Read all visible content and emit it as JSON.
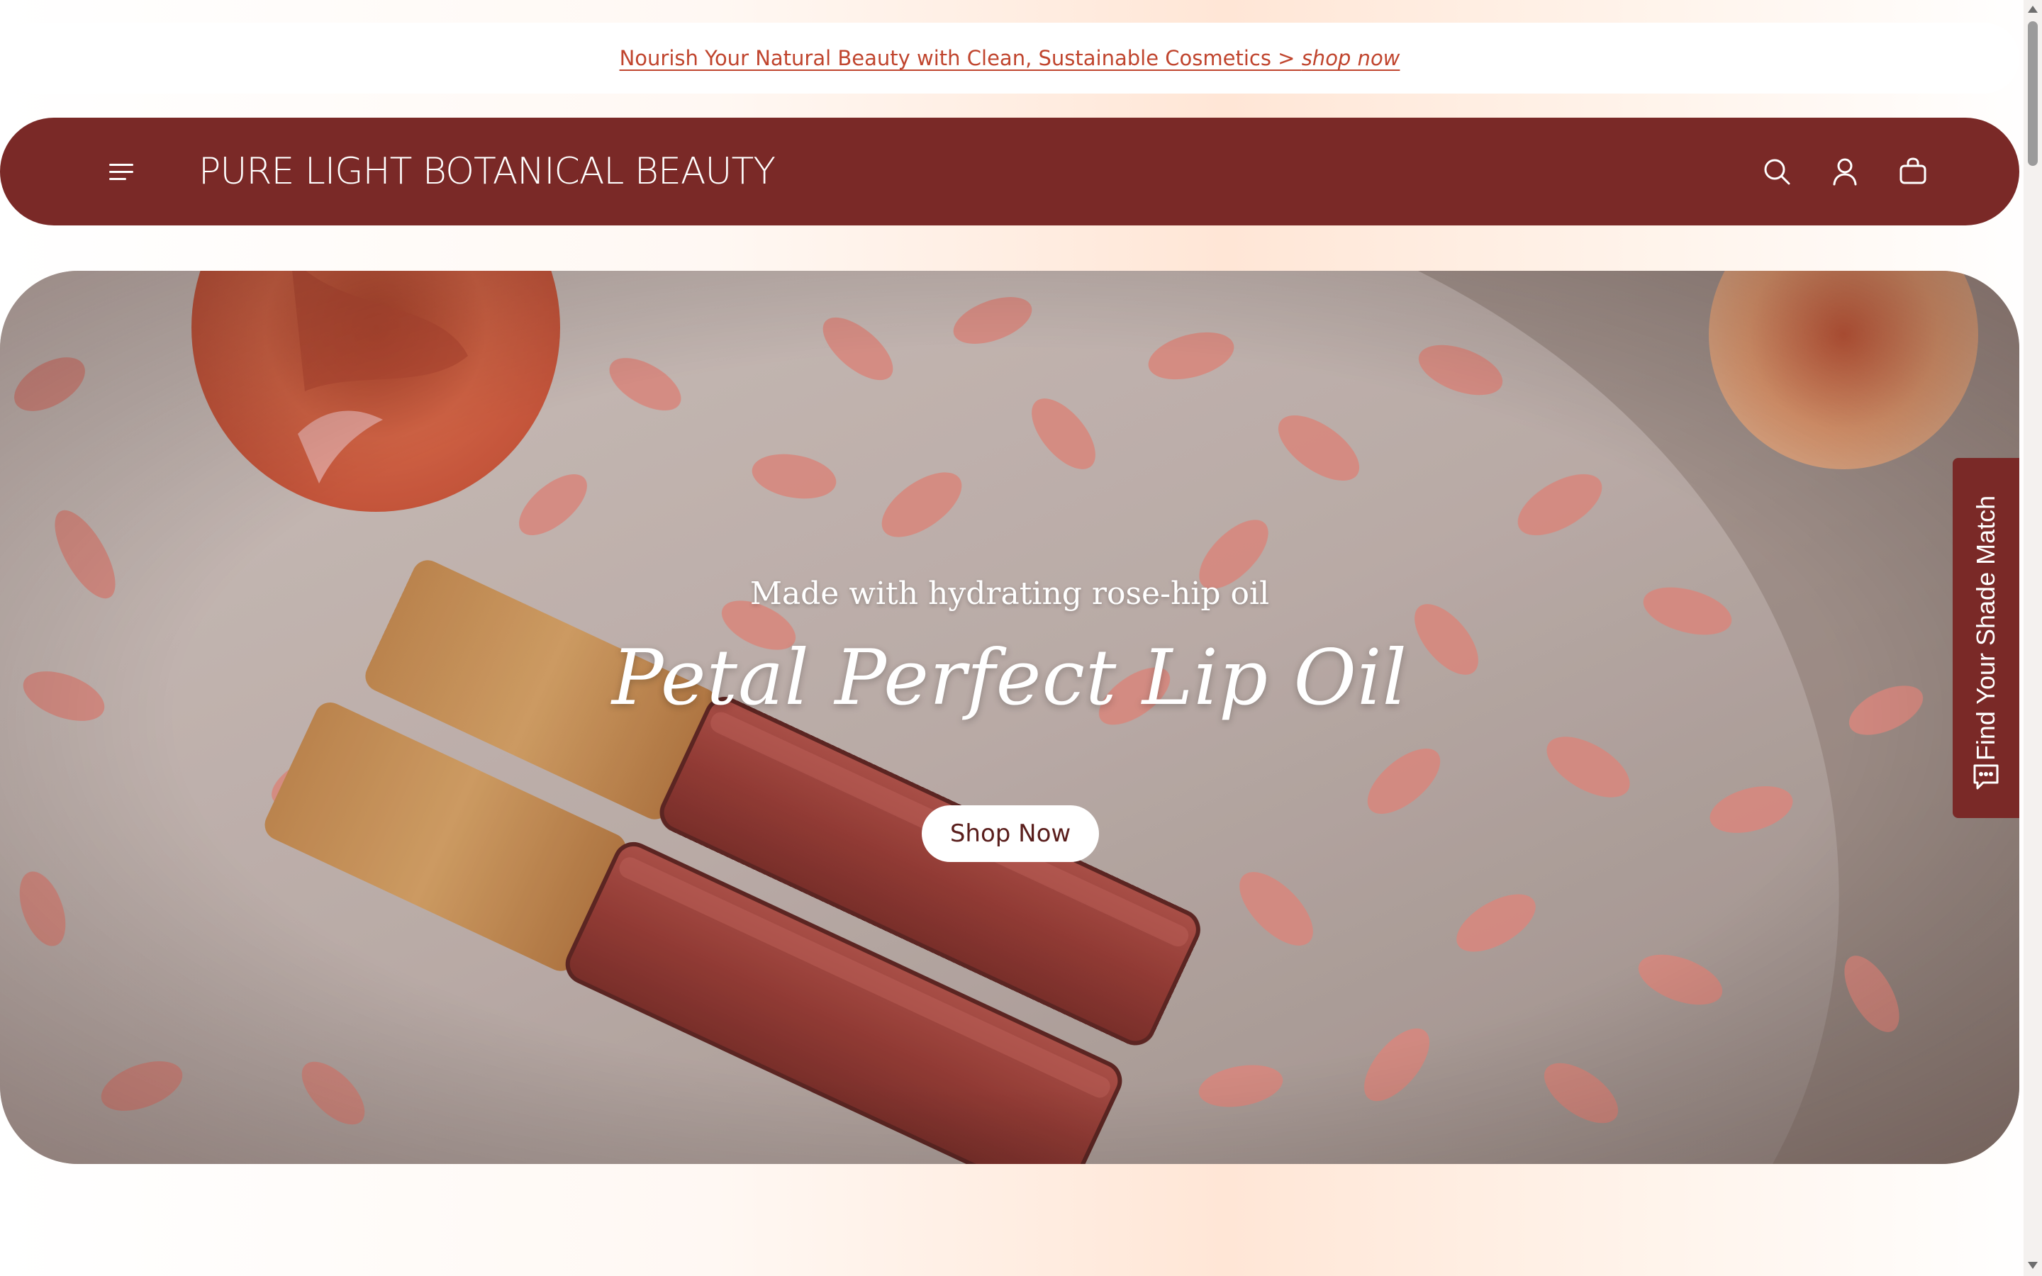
{
  "announcement": {
    "text": "Nourish Your Natural Beauty with Clean, Sustainable Cosmetics > ",
    "cta": "shop now"
  },
  "header": {
    "logo": "PURE LIGHT BOTANICAL BEAUTY",
    "icons": [
      "menu-icon",
      "search-icon",
      "account-icon",
      "cart-icon"
    ]
  },
  "hero": {
    "subtitle": "Made with hydrating rose-hip oil",
    "title": "Petal Perfect Lip Oil",
    "button": "Shop Now"
  },
  "shade_tab": {
    "label": "Find Your Shade Match",
    "icon": "chat-icon"
  },
  "colors": {
    "brand": "#7a2927",
    "announcement_link": "#c0452e",
    "page_background": "#fff3ea"
  }
}
